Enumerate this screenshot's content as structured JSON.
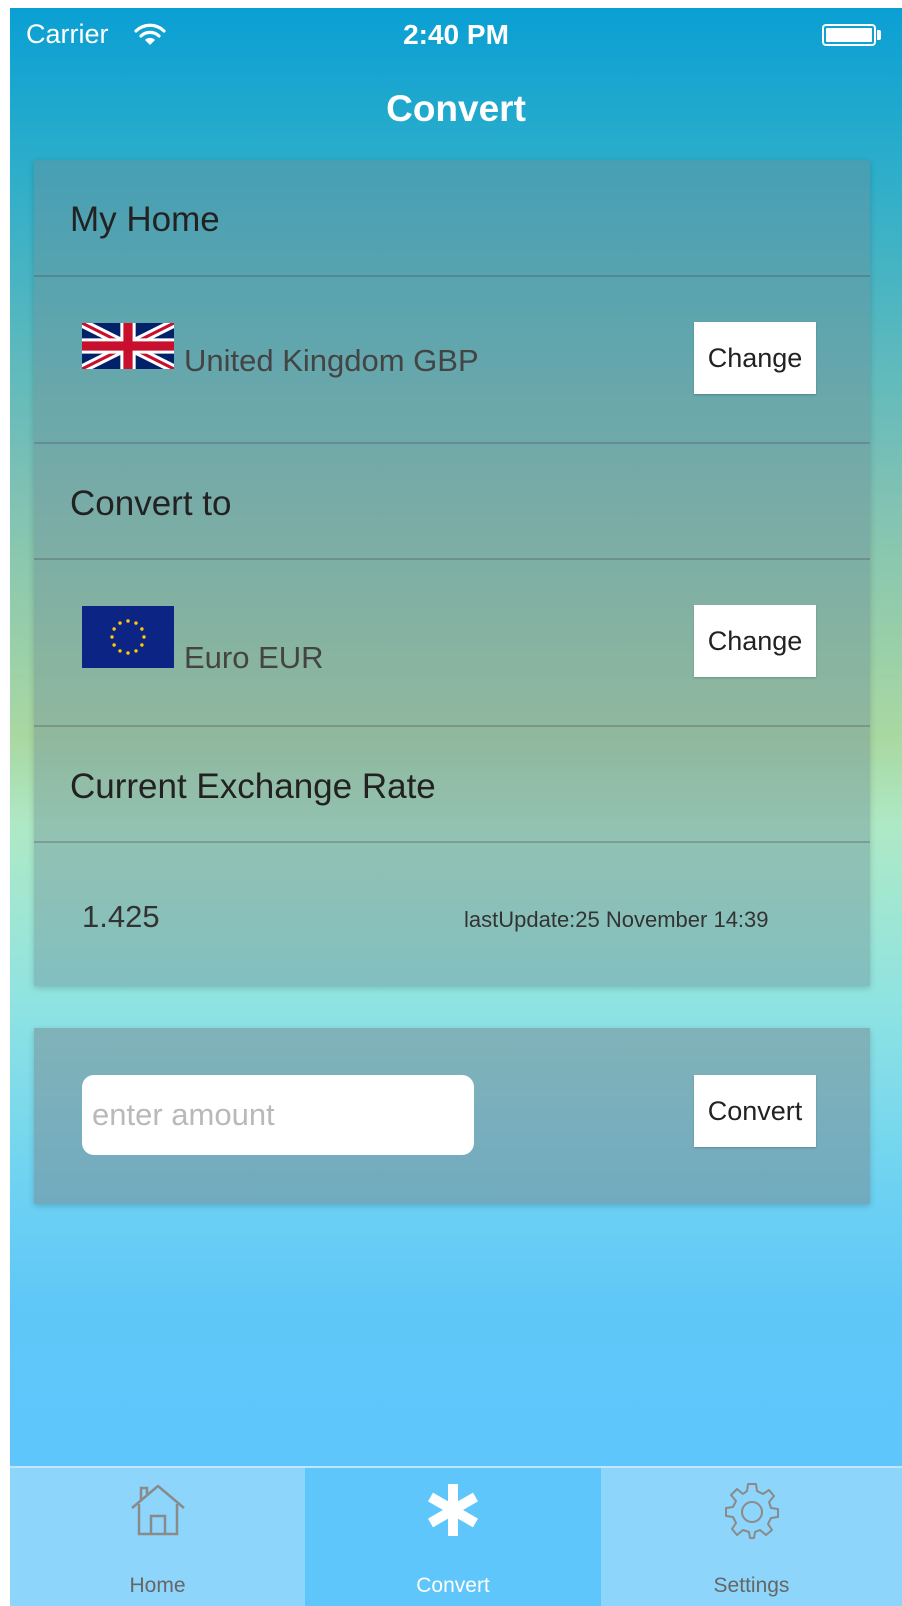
{
  "status_bar": {
    "carrier": "Carrier",
    "time": "2:40 PM"
  },
  "nav": {
    "title": "Convert"
  },
  "home_section": {
    "title": "My Home",
    "currency": "United Kingdom GBP",
    "flag": "uk-flag",
    "change_label": "Change"
  },
  "convert_to_section": {
    "title": "Convert to",
    "currency": "Euro EUR",
    "flag": "eu-flag",
    "change_label": "Change"
  },
  "rate_section": {
    "title": "Current Exchange Rate",
    "value": "1.425",
    "last_update": "lastUpdate:25 November 14:39"
  },
  "amount": {
    "placeholder": "enter amount",
    "value": "",
    "button_label": "Convert"
  },
  "tabs": [
    {
      "label": "Home",
      "icon": "home-icon",
      "active": false
    },
    {
      "label": "Convert",
      "icon": "asterisk-icon",
      "active": true
    },
    {
      "label": "Settings",
      "icon": "gear-icon",
      "active": false
    }
  ],
  "colors": {
    "active_tab": "#5ec6fb",
    "tab_bar": "#8dd5fb",
    "nav_top": "#0a9fd4"
  }
}
